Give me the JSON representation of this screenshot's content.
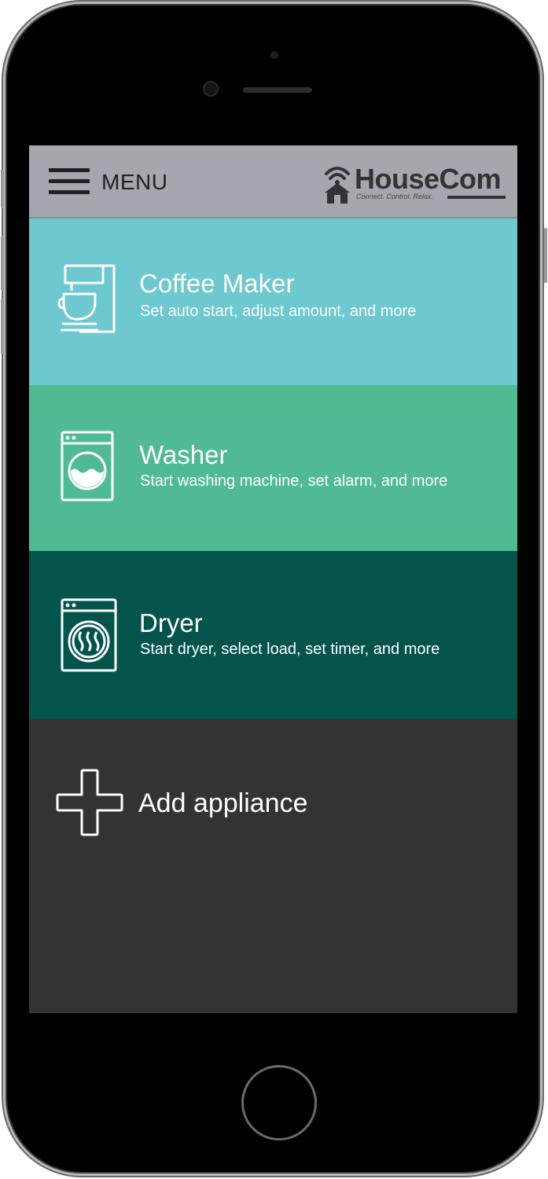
{
  "header": {
    "menu_label": "MENU",
    "logo_name": "HouseCom",
    "logo_tagline": "Connect. Control. Relax."
  },
  "appliances": [
    {
      "title": "Coffee Maker",
      "subtitle": "Set auto start, adjust amount, and more",
      "color": "#6ec8d0",
      "icon": "coffee-maker-icon"
    },
    {
      "title": "Washer",
      "subtitle": "Start washing machine, set alarm, and more",
      "color": "#50bb92",
      "icon": "washer-icon"
    },
    {
      "title": "Dryer",
      "subtitle": "Start dryer, select load, set timer, and more",
      "color": "#04544d",
      "icon": "dryer-icon"
    }
  ],
  "add": {
    "label": "Add appliance",
    "icon": "plus-icon",
    "color": "#333333"
  }
}
